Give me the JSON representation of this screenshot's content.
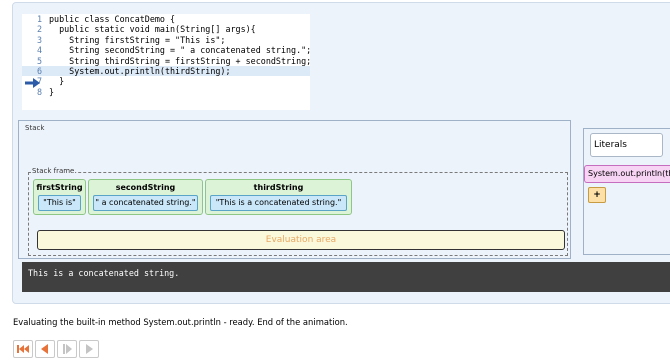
{
  "code": {
    "lines": [
      {
        "n": "1",
        "text": "public class ConcatDemo {"
      },
      {
        "n": "2",
        "text": "  public static void main(String[] args){"
      },
      {
        "n": "3",
        "text": "    String firstString = \"This is\";"
      },
      {
        "n": "4",
        "text": "    String secondString = \" a concatenated string.\";"
      },
      {
        "n": "5",
        "text": "    String thirdString = firstString + secondString;"
      },
      {
        "n": "6",
        "text": "    System.out.println(thirdString);"
      },
      {
        "n": "7",
        "text": "  }"
      },
      {
        "n": "8",
        "text": "}"
      }
    ],
    "current_line": "6",
    "arrow_icon": "current-line-arrow-icon"
  },
  "stack": {
    "label": "Stack",
    "frame_label": "Stack frame",
    "variables": [
      {
        "name": "firstString",
        "value": "\"This is\""
      },
      {
        "name": "secondString",
        "value": "\" a concatenated string.\""
      },
      {
        "name": "thirdString",
        "value": "\"This is a concatenated string.\""
      }
    ],
    "evaluation_area": "Evaluation area"
  },
  "console": {
    "output": "This is a concatenated string."
  },
  "literals": {
    "title": "Literals",
    "method": "System.out.println(thirdString)",
    "operator": "+"
  },
  "status": "Evaluating the built-in method System.out.println - ready. End of the animation.",
  "controls": {
    "icons": [
      "rewind-to-start-icon",
      "step-back-icon",
      "play-step-icon",
      "forward-icon"
    ]
  },
  "colors": {
    "panel_bg": "#edf3fb",
    "code_highlight": "#dce9f7",
    "variable_box": "#ddf3d7",
    "value_box": "#c9e7f9",
    "console_bg": "#404040",
    "method_literal": "#f7d4f4",
    "operator_literal": "#fde0a8",
    "accent_orange": "#e8733a"
  }
}
